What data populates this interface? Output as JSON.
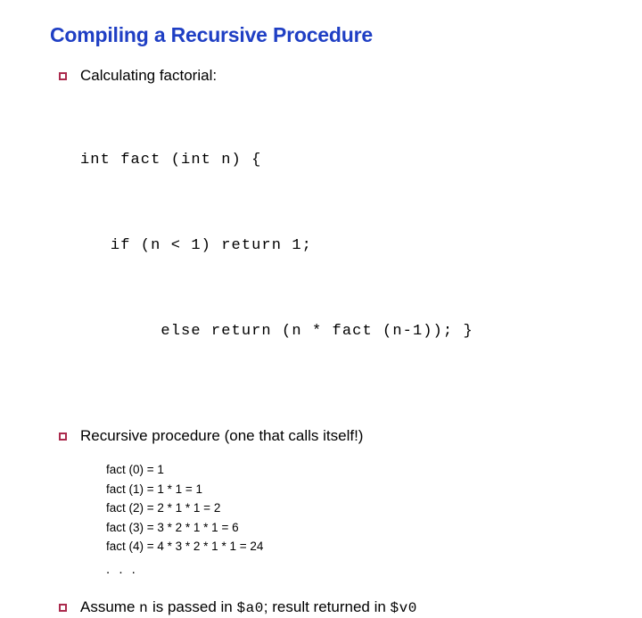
{
  "slide": {
    "title": "Compiling a Recursive Procedure",
    "title_color": "#1f3fc4",
    "bullet_color": "#ab2b4d",
    "background_color": "#ffffff",
    "text_color": "#000000"
  },
  "bullets": [
    {
      "marker": "hollow-square-bullet",
      "text": "Calculating factorial:"
    },
    {
      "marker": "hollow-square-bullet",
      "text": "Recursive procedure (one that calls itself!)"
    }
  ],
  "code": {
    "lines": [
      "int fact (int n) {",
      "   if (n < 1) return 1;",
      "        else return (n * fact (n-1)); }"
    ]
  },
  "sublist": {
    "items": [
      "fact (0) = 1",
      "fact (1) = 1 * 1 = 1",
      "fact (2) = 2 * 1 * 1 = 2",
      "fact (3) = 3 * 2 * 1 * 1 = 6",
      "fact (4) = 4 * 3 * 2 * 1 * 1 = 24"
    ],
    "ellipsis": ". . ."
  },
  "final_bullet": {
    "marker": "hollow-square-bullet",
    "part1": "Assume ",
    "code1": "n",
    "part2": " is passed in ",
    "code2": "$a0",
    "part3": "; result returned in ",
    "code3": "$v0"
  }
}
